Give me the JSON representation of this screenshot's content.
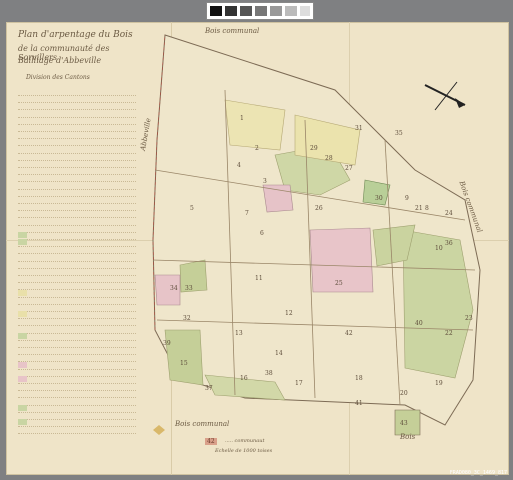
{
  "title_lines": [
    "Plan d'arpentage du Bois",
    "de la communauté des Sorvillers",
    "Bailliage d'Abbeville",
    "Division des Cantons"
  ],
  "map_labels": {
    "top": "Bois communal",
    "bottom": "Bois communal",
    "left": "Abbeville",
    "right": "Bois communal",
    "bottom_right": "Bois"
  },
  "parcel_numbers": [
    "1",
    "2",
    "3",
    "4",
    "5",
    "6",
    "7",
    "8",
    "9",
    "10",
    "11",
    "12",
    "13",
    "14",
    "15",
    "16",
    "17",
    "18",
    "19",
    "20",
    "21",
    "22",
    "23",
    "24",
    "25",
    "26",
    "27",
    "28",
    "29",
    "30",
    "31",
    "32",
    "33",
    "34",
    "35",
    "36",
    "37",
    "38",
    "39",
    "40",
    "41",
    "42",
    "43"
  ],
  "scale_note": "Echelle de 1000 toises",
  "legend_marker": "42",
  "legend_marker_text": "..... communaut",
  "colors": {
    "paper": "#efe4c8",
    "meadow": "#c9d5a3",
    "pink": "#e8c4c8",
    "yellow": "#e9e0a9",
    "ink": "#6b5a43"
  },
  "reference": "FRAD080_3C_1469_817"
}
